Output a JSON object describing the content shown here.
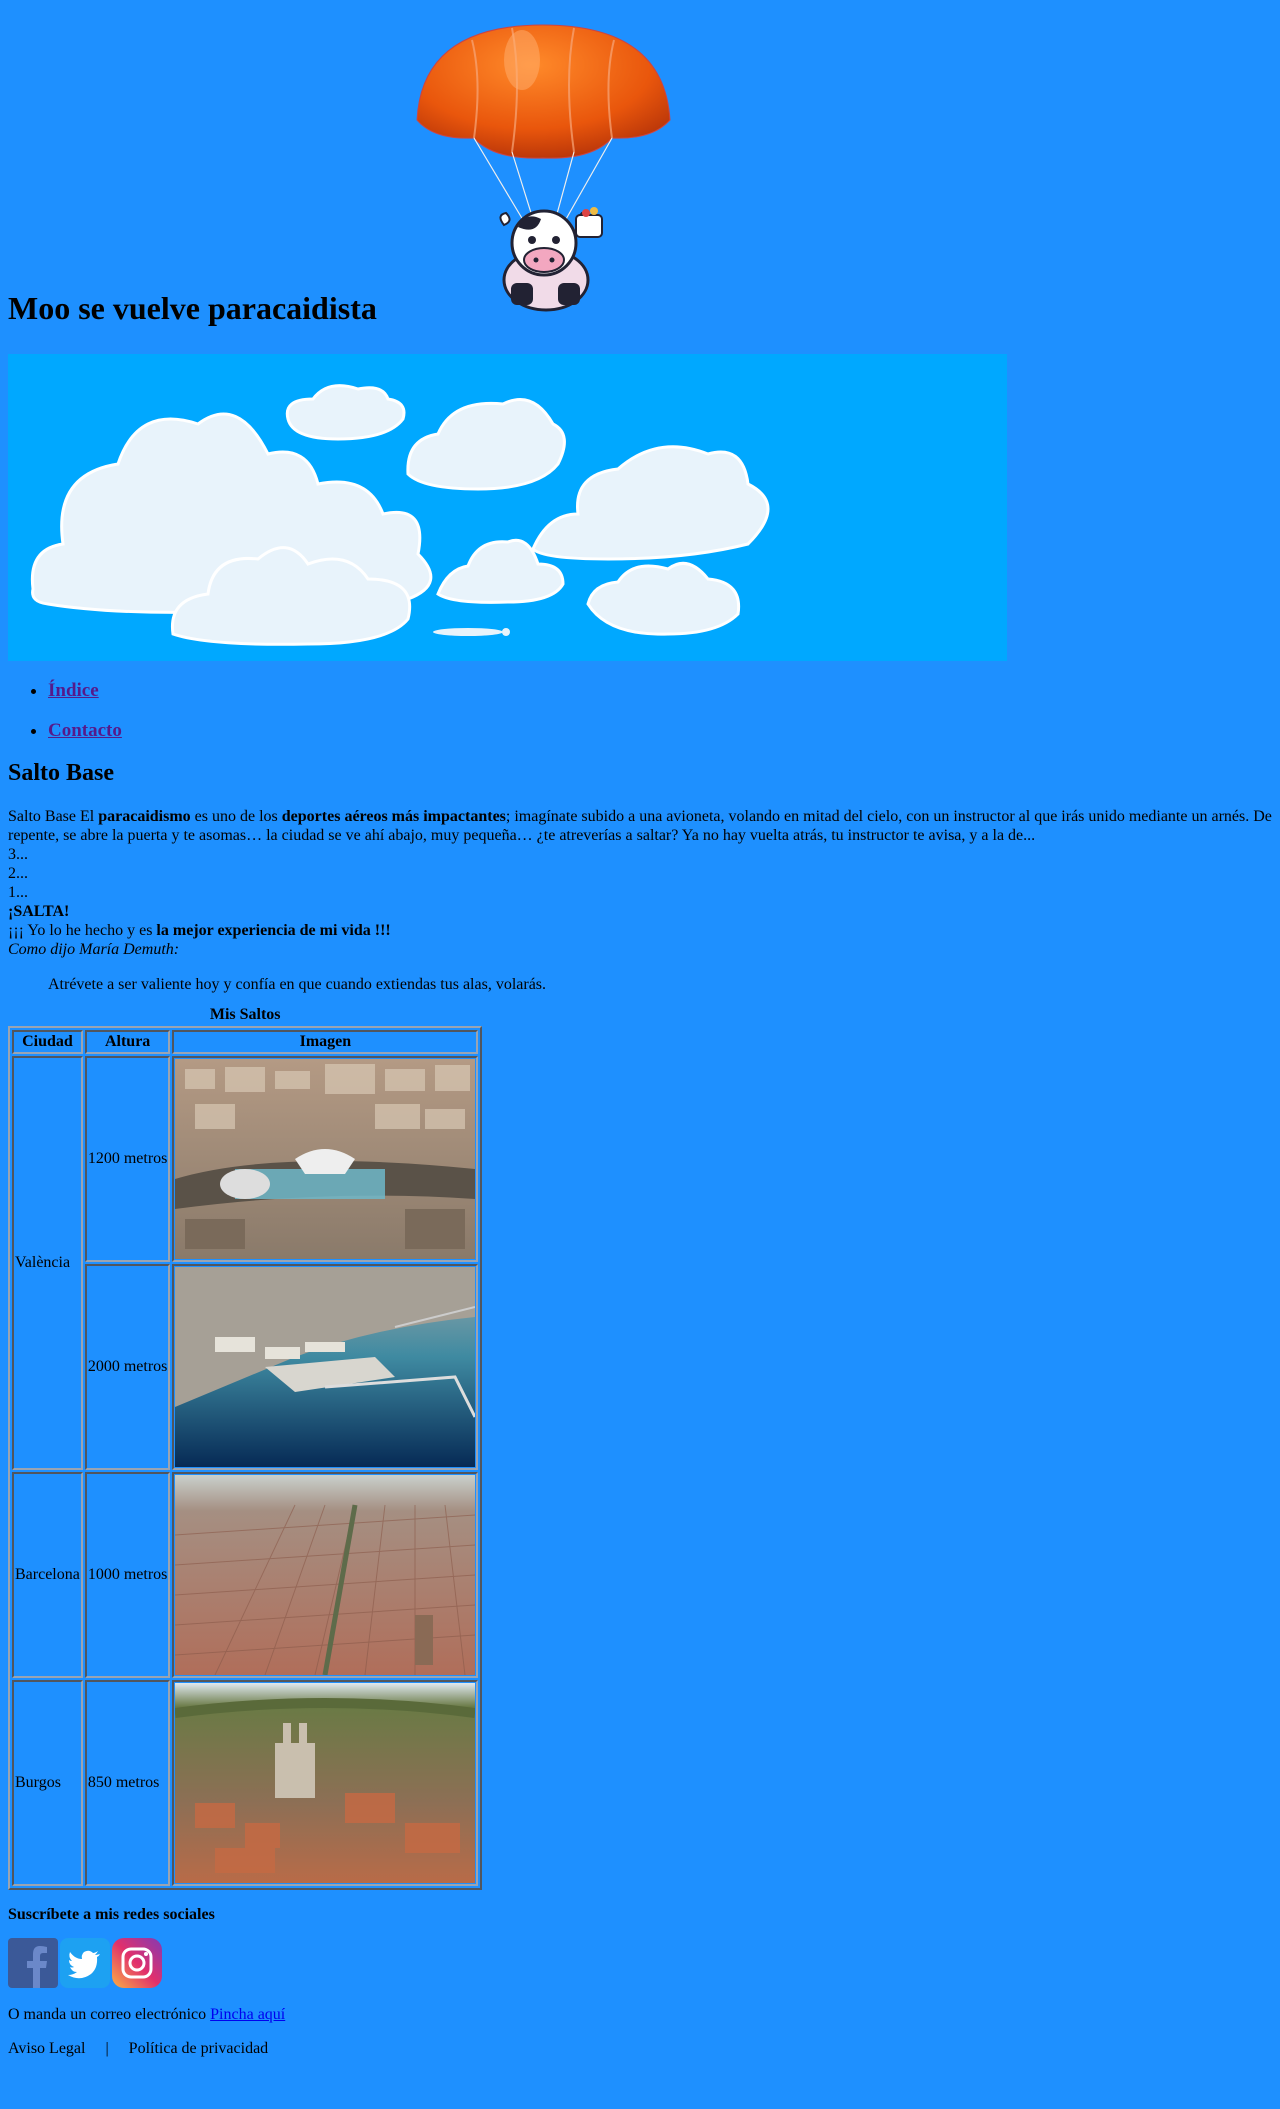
{
  "header": {
    "title": "Moo se vuelve paracaidista",
    "logo_icon": "parachute-cow-icon"
  },
  "banner": {
    "image_icon": "clouds-banner"
  },
  "nav": {
    "items": [
      {
        "label": "Índice"
      },
      {
        "label": "Contacto"
      }
    ]
  },
  "section": {
    "title": "Salto Base",
    "intro_lead": "Salto Base El ",
    "intro_bold_1": "paracaidismo",
    "intro_mid_1": " es uno de los ",
    "intro_bold_2": "deportes aéreos más impactantes",
    "intro_rest": "; imagínate subido a una avioneta, volando en mitad del cielo, con un instructor al que irás unido mediante un arnés. De repente, se abre la puerta y te asomas… la ciudad se ve ahí abajo, muy pequeña… ¿te atreverías a saltar? Ya no hay vuelta atrás, tu instructor te avisa, y a la de...",
    "count_3": "3...",
    "count_2": "2...",
    "count_1": "1...",
    "jump": "¡SALTA!",
    "experience_lead": "¡¡¡ Yo lo he hecho y es ",
    "experience_bold": "la mejor experiencia de mi vida !!!",
    "quote_intro": "Como dijo María Demuth:",
    "quote": "Atrévete a ser valiente hoy y confía en que cuando extiendas tus alas, volarás."
  },
  "table": {
    "caption": "Mis Saltos",
    "headers": [
      "Ciudad",
      "Altura",
      "Imagen"
    ],
    "rows": [
      {
        "city": "València",
        "height": "1200 metros",
        "image": "valencia-aerial-photo"
      },
      {
        "city": "",
        "height": "2000 metros",
        "image": "valencia-port-photo"
      },
      {
        "city": "Barcelona",
        "height": "1000 metros",
        "image": "barcelona-aerial-photo"
      },
      {
        "city": "Burgos",
        "height": "850 metros",
        "image": "burgos-aerial-photo"
      }
    ]
  },
  "social": {
    "heading": "Suscríbete a mis redes sociales",
    "icons": [
      "facebook-icon",
      "twitter-icon",
      "instagram-icon"
    ]
  },
  "contact": {
    "text": "O manda un correo electrónico ",
    "link": "Pincha aquí"
  },
  "footer": {
    "legal": "Aviso Legal",
    "separator": "|",
    "privacy": "Política de privacidad"
  },
  "colors": {
    "background": "#1e90ff",
    "sky": "#00a8ff",
    "visited_link": "#551a8b",
    "link": "#0000ee"
  }
}
